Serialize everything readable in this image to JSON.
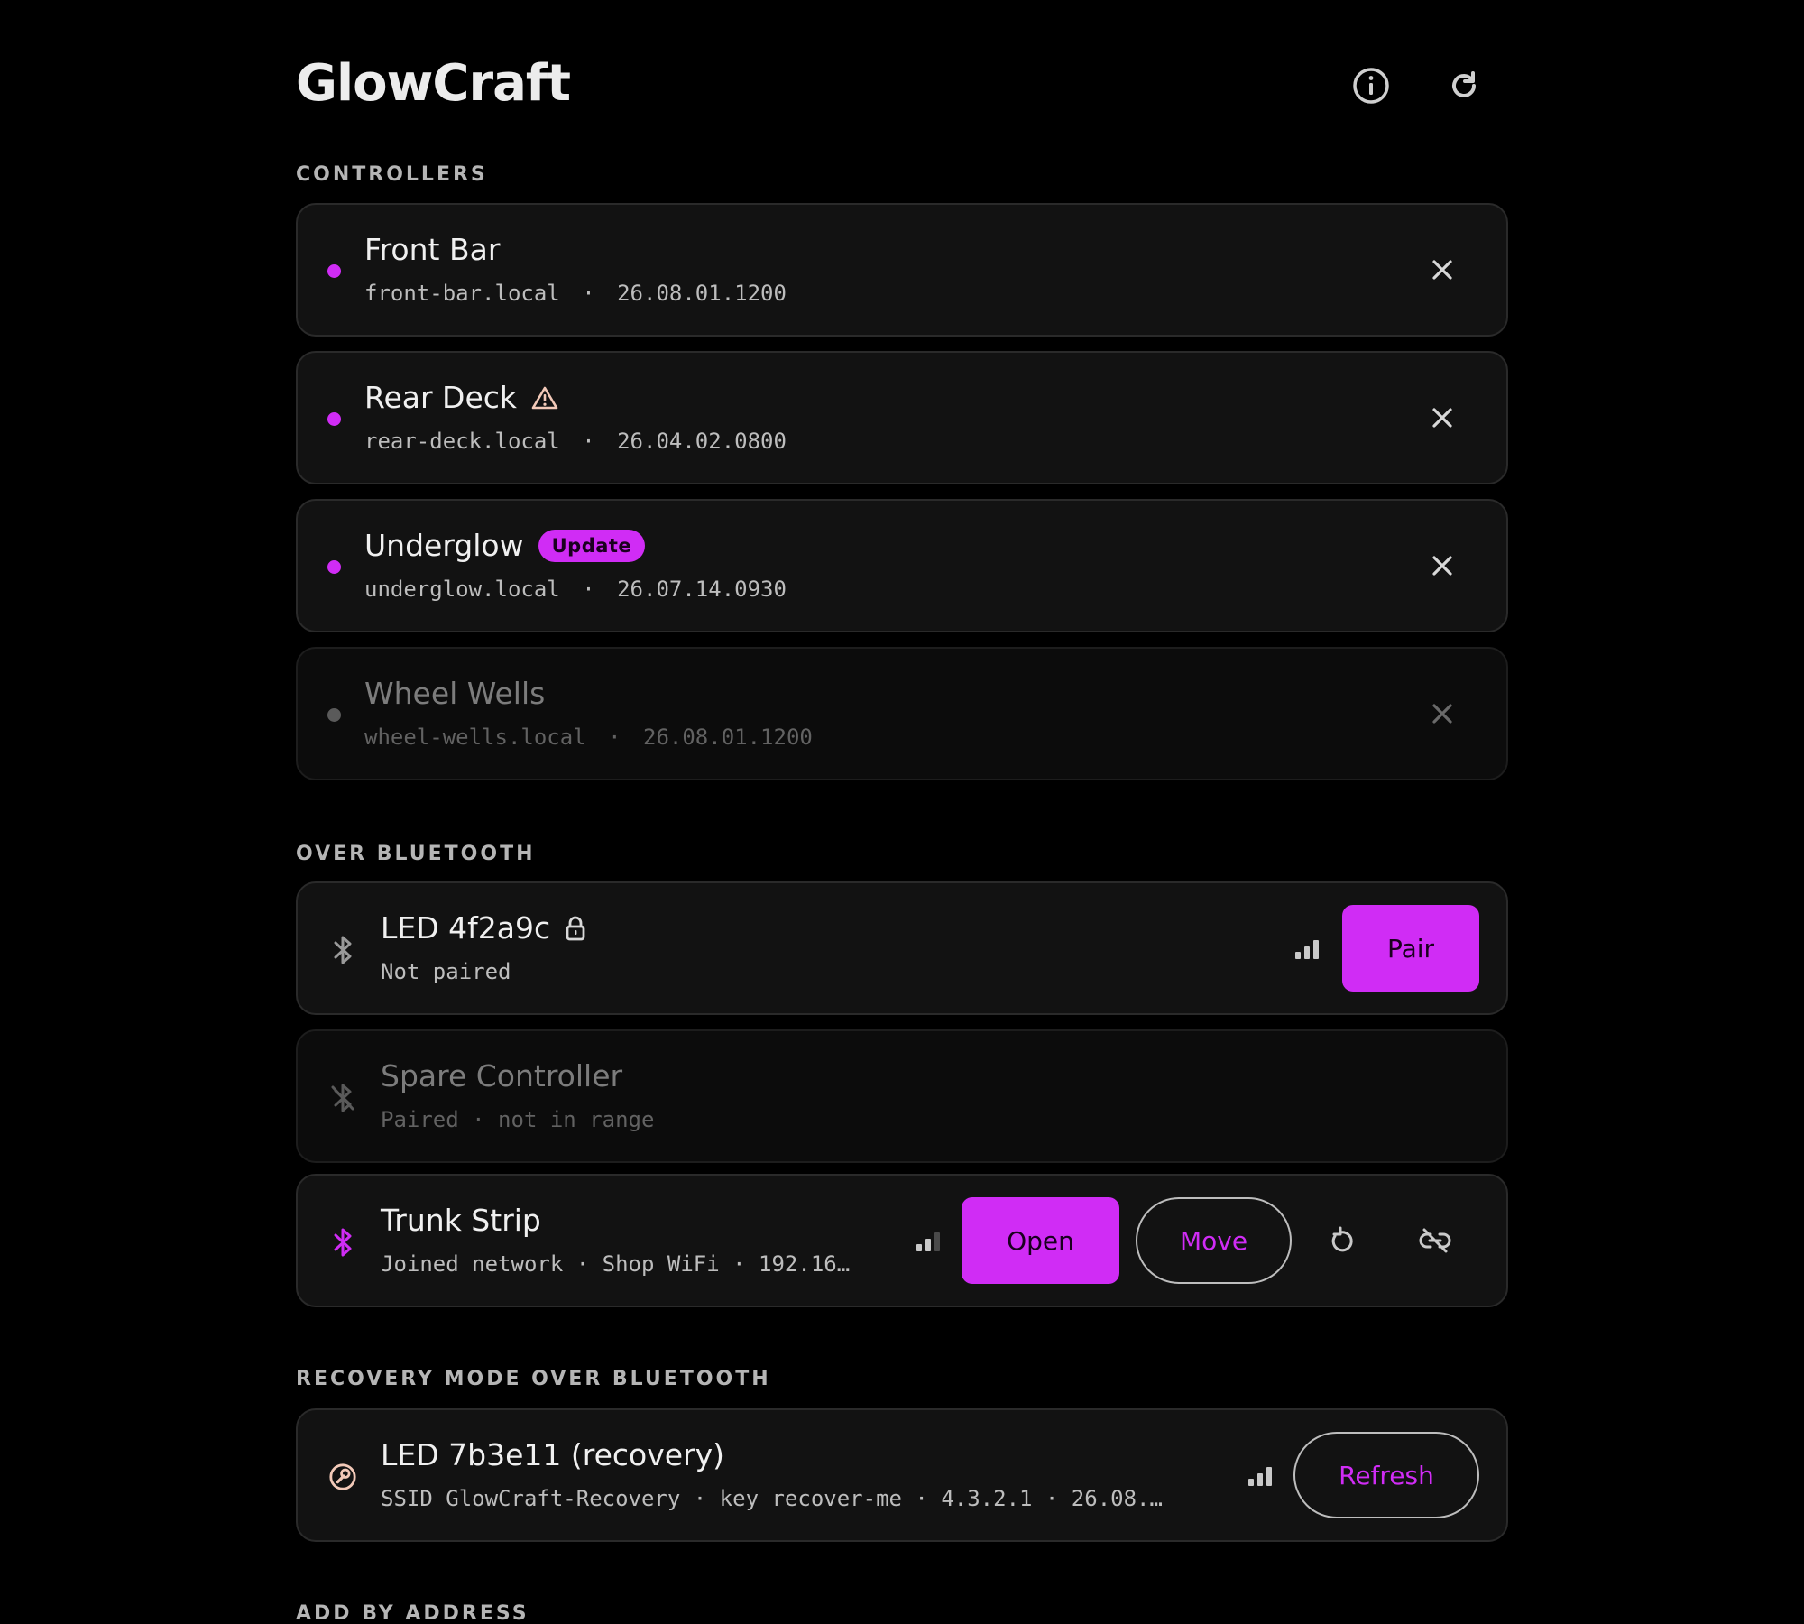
{
  "app": {
    "title": "GlowCraft"
  },
  "header": {
    "info_icon": "info-circle-icon",
    "refresh_icon": "refresh-icon"
  },
  "sections": {
    "controllers": "CONTROLLERS",
    "bluetooth": "OVER BLUETOOTH",
    "recovery": "RECOVERY MODE OVER BLUETOOTH",
    "add": "ADD BY ADDRESS"
  },
  "controllers": [
    {
      "name": "Front Bar",
      "host": "front-bar.local",
      "version": "26.08.01.1200",
      "online": true
    },
    {
      "name": "Rear Deck",
      "host": "rear-deck.local",
      "version": "26.04.02.0800",
      "online": true,
      "warning_icon": "warning-triangle-icon"
    },
    {
      "name": "Underglow",
      "host": "underglow.local",
      "version": "26.07.14.0930",
      "online": true,
      "badge": "Update"
    },
    {
      "name": "Wheel Wells",
      "host": "wheel-wells.local",
      "version": "26.08.01.1200",
      "online": false
    }
  ],
  "bluetooth": [
    {
      "name": "LED 4f2a9c",
      "status": "Not paired",
      "locked_icon": "lock-icon",
      "signal_bars": 3,
      "action": "Pair"
    },
    {
      "name": "Spare Controller",
      "status": "Paired · not in range"
    },
    {
      "name": "Trunk Strip",
      "status": "Joined network · Shop WiFi · 192.16…",
      "signal_bars": 2,
      "open_label": "Open",
      "move_label": "Move"
    }
  ],
  "recovery": [
    {
      "name": "LED 7b3e11 (recovery)",
      "status": "SSID GlowCraft-Recovery · key recover-me · 4.3.2.1 · 26.08.…",
      "signal_bars": 3,
      "action": "Refresh"
    }
  ],
  "separator": "·",
  "colors": {
    "accent": "#d02cf5",
    "card": "#121212",
    "background": "#000000"
  }
}
